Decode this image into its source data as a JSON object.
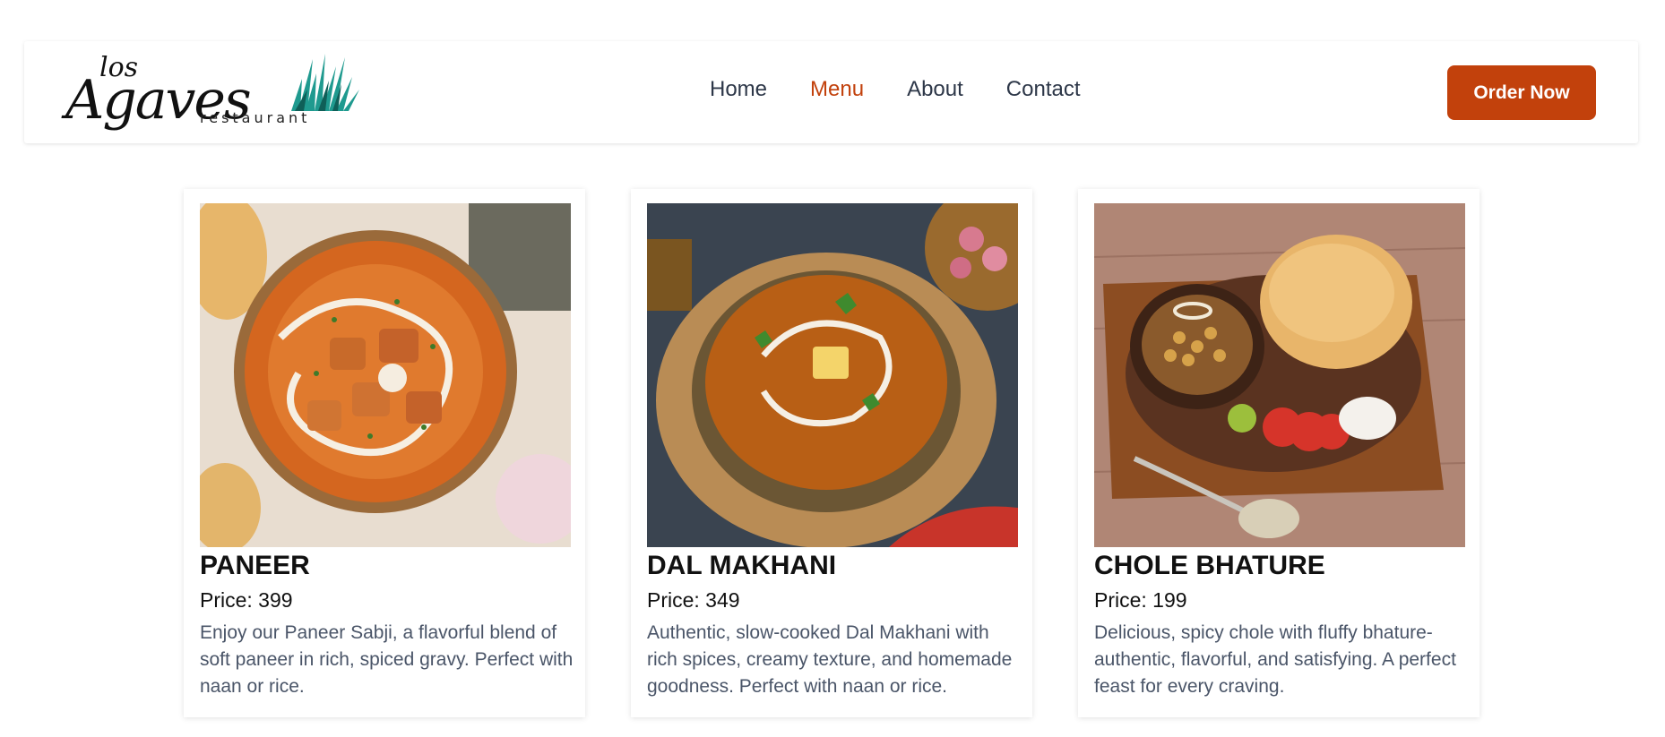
{
  "brand": {
    "logo_small": "los",
    "logo_main": "Agaves",
    "logo_sub": "restaurant"
  },
  "nav": {
    "links": [
      {
        "label": "Home",
        "active": false
      },
      {
        "label": "Menu",
        "active": true
      },
      {
        "label": "About",
        "active": false
      },
      {
        "label": "Contact",
        "active": false
      }
    ],
    "cta_label": "Order Now"
  },
  "colors": {
    "accent": "#c2410c",
    "nav_text": "#2d3748",
    "body_text": "#4a5568"
  },
  "menu_items": [
    {
      "title": "PANEER",
      "price": "Price: 399",
      "description": "Enjoy our Paneer Sabji, a flavorful blend of soft paneer in rich, spiced gravy. Perfect with naan or rice."
    },
    {
      "title": "DAL MAKHANI",
      "price": "Price: 349",
      "description": "Authentic, slow-cooked Dal Makhani with rich spices, creamy texture, and homemade goodness. Perfect with naan or rice."
    },
    {
      "title": "CHOLE BHATURE",
      "price": "Price: 199",
      "description": "Delicious, spicy chole with fluffy bhature-authentic, flavorful, and satisfying. A perfect feast for every craving."
    }
  ]
}
